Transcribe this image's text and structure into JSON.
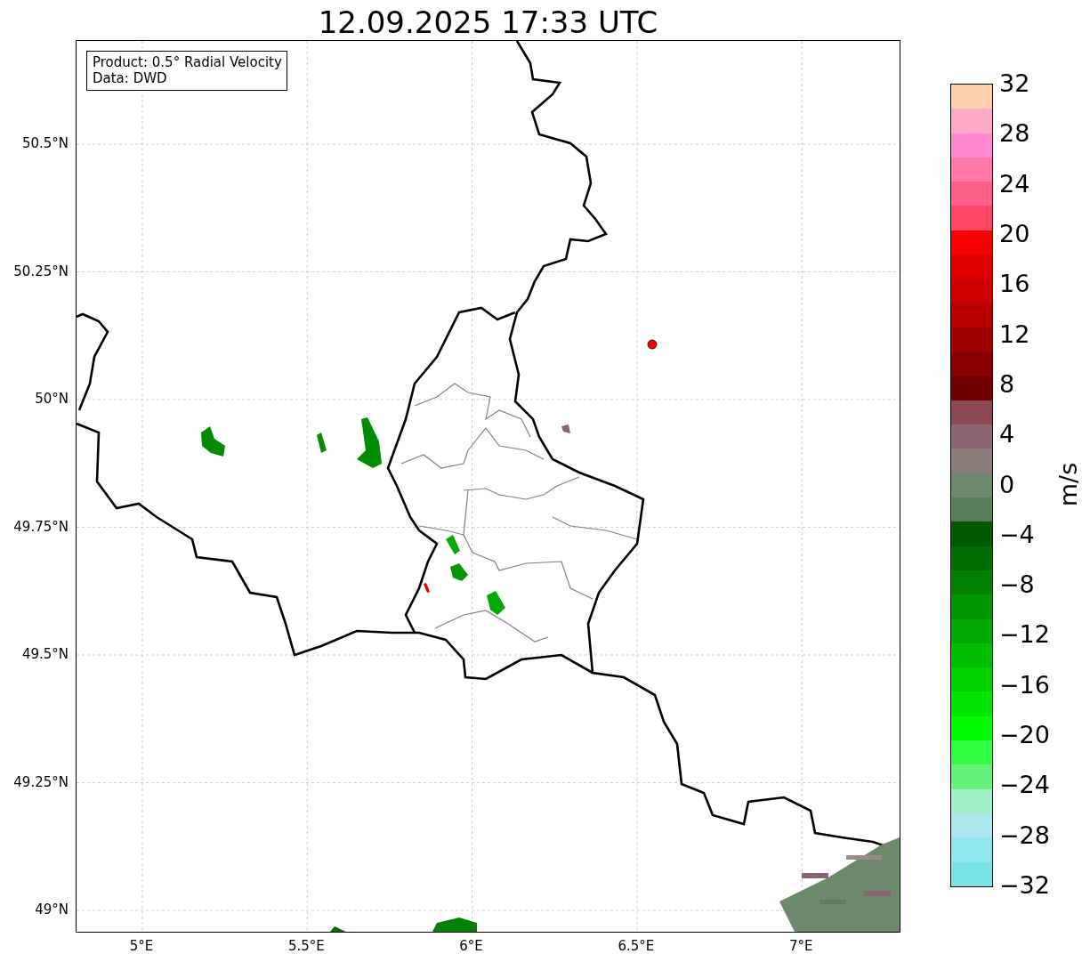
{
  "title": "12.09.2025 17:33 UTC",
  "legend": [
    "Product: 0.5° Radial Velocity",
    "Data: DWD"
  ],
  "lat_ticks": [
    "50.5°N",
    "50.25°N",
    "50°N",
    "49.75°N",
    "49.5°N",
    "49.25°N",
    "49°N"
  ],
  "lon_ticks": [
    "5°E",
    "5.5°E",
    "6°E",
    "6.5°E",
    "7°E"
  ],
  "colorbar": {
    "label": "m/s",
    "ticks": [
      "32",
      "28",
      "24",
      "20",
      "16",
      "12",
      "8",
      "4",
      "0",
      "−4",
      "−8",
      "−12",
      "−16",
      "−20",
      "−24",
      "−28",
      "−32"
    ],
    "segments": [
      {
        "color": "#ffd0b0"
      },
      {
        "color": "#ffa8c8"
      },
      {
        "color": "#ff88d0"
      },
      {
        "color": "#ff78a8"
      },
      {
        "color": "#ff6088"
      },
      {
        "color": "#ff4868"
      },
      {
        "color": "#f80000"
      },
      {
        "color": "#e00000"
      },
      {
        "color": "#cc0000"
      },
      {
        "color": "#b80000"
      },
      {
        "color": "#a00000"
      },
      {
        "color": "#8a0000"
      },
      {
        "color": "#700000"
      },
      {
        "color": "#8a4a50"
      },
      {
        "color": "#8a6470"
      },
      {
        "color": "#8a7a78"
      },
      {
        "color": "#6a8a6a"
      },
      {
        "color": "#5a7d5a"
      },
      {
        "color": "#005a00"
      },
      {
        "color": "#006e00"
      },
      {
        "color": "#008200"
      },
      {
        "color": "#009600"
      },
      {
        "color": "#00aa00"
      },
      {
        "color": "#00be00"
      },
      {
        "color": "#00d200"
      },
      {
        "color": "#00e600"
      },
      {
        "color": "#00fa00"
      },
      {
        "color": "#30ff40"
      },
      {
        "color": "#66f27a"
      },
      {
        "color": "#a0f0c8"
      },
      {
        "color": "#aee8ee"
      },
      {
        "color": "#90e8ec"
      },
      {
        "color": "#78e4e8"
      }
    ]
  }
}
